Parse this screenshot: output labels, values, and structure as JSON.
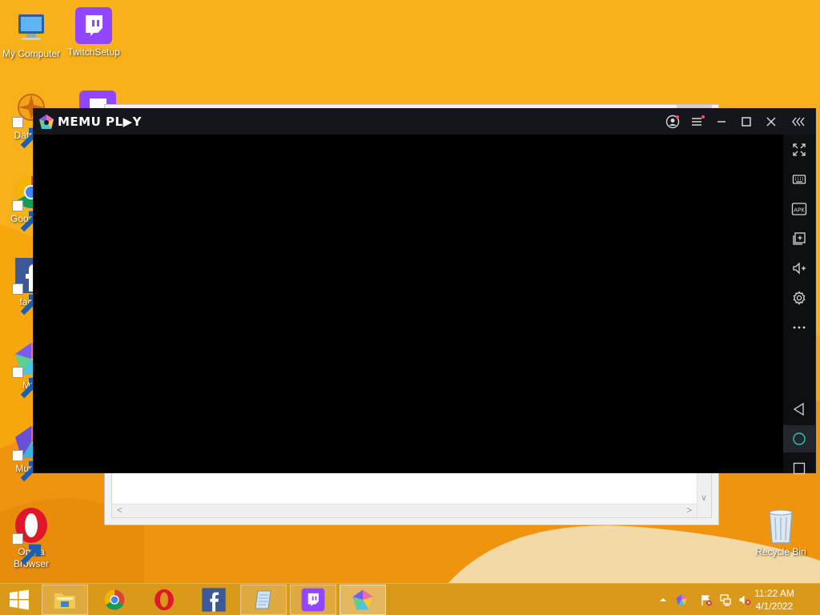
{
  "desktop": {
    "icons": [
      {
        "label": "My Computer"
      },
      {
        "label": "TwitchSetup"
      },
      {
        "label": "DataWa"
      },
      {
        "label": "Goo Chro"
      },
      {
        "label": "faceb"
      },
      {
        "label": "MEr"
      },
      {
        "label": "Multi-M"
      },
      {
        "label": "Opera Browser"
      },
      {
        "label": "Recycle Bin"
      }
    ]
  },
  "memu": {
    "title": "MEMU PL▶Y",
    "titlebar_buttons": [
      "account-icon",
      "menu-icon",
      "minimize-icon",
      "maximize-icon",
      "close-icon",
      "collapse-sidebar-icon"
    ],
    "sidebar": [
      "fullscreen-icon",
      "keyboard-icon",
      "apk-icon",
      "multi-window-icon",
      "volume-up-icon",
      "settings-icon",
      "more-icon",
      "back-icon",
      "home-icon",
      "recents-icon"
    ],
    "apk_label": "APK"
  },
  "taskbar": {
    "pinned": [
      "start-button",
      "file-explorer",
      "chrome",
      "opera",
      "facebook",
      "notepad",
      "twitch",
      "memu"
    ],
    "clock": {
      "time": "11:22 AM",
      "date": "4/1/2022"
    }
  },
  "colors": {
    "wallpaper": "#f6a70c",
    "memu_titlebar": "#14161b",
    "memu_accent": "#2fc7a8",
    "twitch_purple": "#9146ff"
  }
}
